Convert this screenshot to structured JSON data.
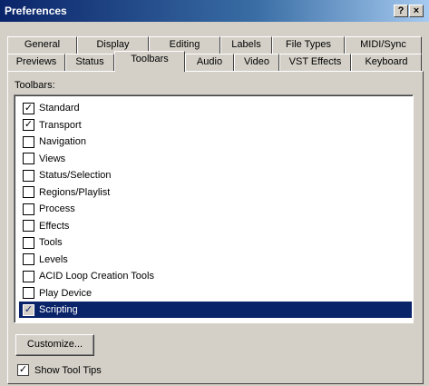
{
  "window": {
    "title": "Preferences",
    "help_label": "?",
    "close_label": "×"
  },
  "tabs_back": [
    "General",
    "Display",
    "Editing",
    "Labels",
    "File Types",
    "MIDI/Sync"
  ],
  "tabs_front": [
    "Previews",
    "Status",
    "Toolbars",
    "Audio",
    "Video",
    "VST Effects",
    "Keyboard"
  ],
  "active_tab": "Toolbars",
  "toolbars_label": "Toolbars:",
  "toolbars": [
    {
      "label": "Standard",
      "checked": true
    },
    {
      "label": "Transport",
      "checked": true
    },
    {
      "label": "Navigation",
      "checked": false
    },
    {
      "label": "Views",
      "checked": false
    },
    {
      "label": "Status/Selection",
      "checked": false
    },
    {
      "label": "Regions/Playlist",
      "checked": false
    },
    {
      "label": "Process",
      "checked": false
    },
    {
      "label": "Effects",
      "checked": false
    },
    {
      "label": "Tools",
      "checked": false
    },
    {
      "label": "Levels",
      "checked": false
    },
    {
      "label": "ACID Loop Creation Tools",
      "checked": false
    },
    {
      "label": "Play Device",
      "checked": false
    },
    {
      "label": "Scripting",
      "checked": true,
      "selected": true
    }
  ],
  "customize_label": "Customize...",
  "show_tooltips": {
    "label": "Show Tool Tips",
    "checked": true
  },
  "checkmark": "✓"
}
